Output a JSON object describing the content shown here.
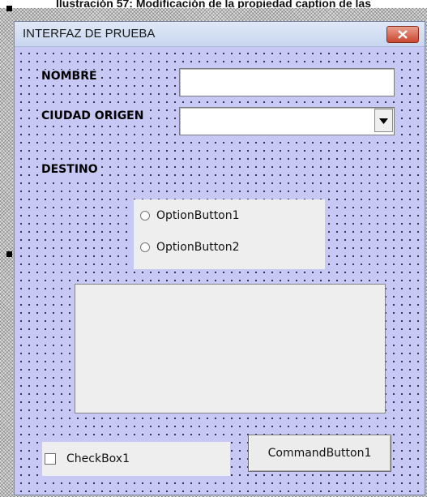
{
  "page_caption": "Ilustración 57: Modificación de la propiedad caption de las",
  "form": {
    "title": "INTERFAZ DE PRUEBA",
    "labels": {
      "nombre": "NOMBRE",
      "ciudad_origen": "CIUDAD ORIGEN",
      "destino": "DESTINO"
    },
    "nombre_value": "",
    "ciudad_value": "",
    "options": [
      {
        "label": "OptionButton1",
        "selected": false
      },
      {
        "label": "OptionButton2",
        "selected": false
      }
    ],
    "checkbox_label": "CheckBox1",
    "checkbox_checked": false,
    "command_label": "CommandButton1"
  },
  "icons": {
    "close": "close-icon",
    "dropdown": "chevron-down-icon"
  },
  "colors": {
    "client_bg": "#c8c8f4",
    "close_red": "#c9462f"
  }
}
